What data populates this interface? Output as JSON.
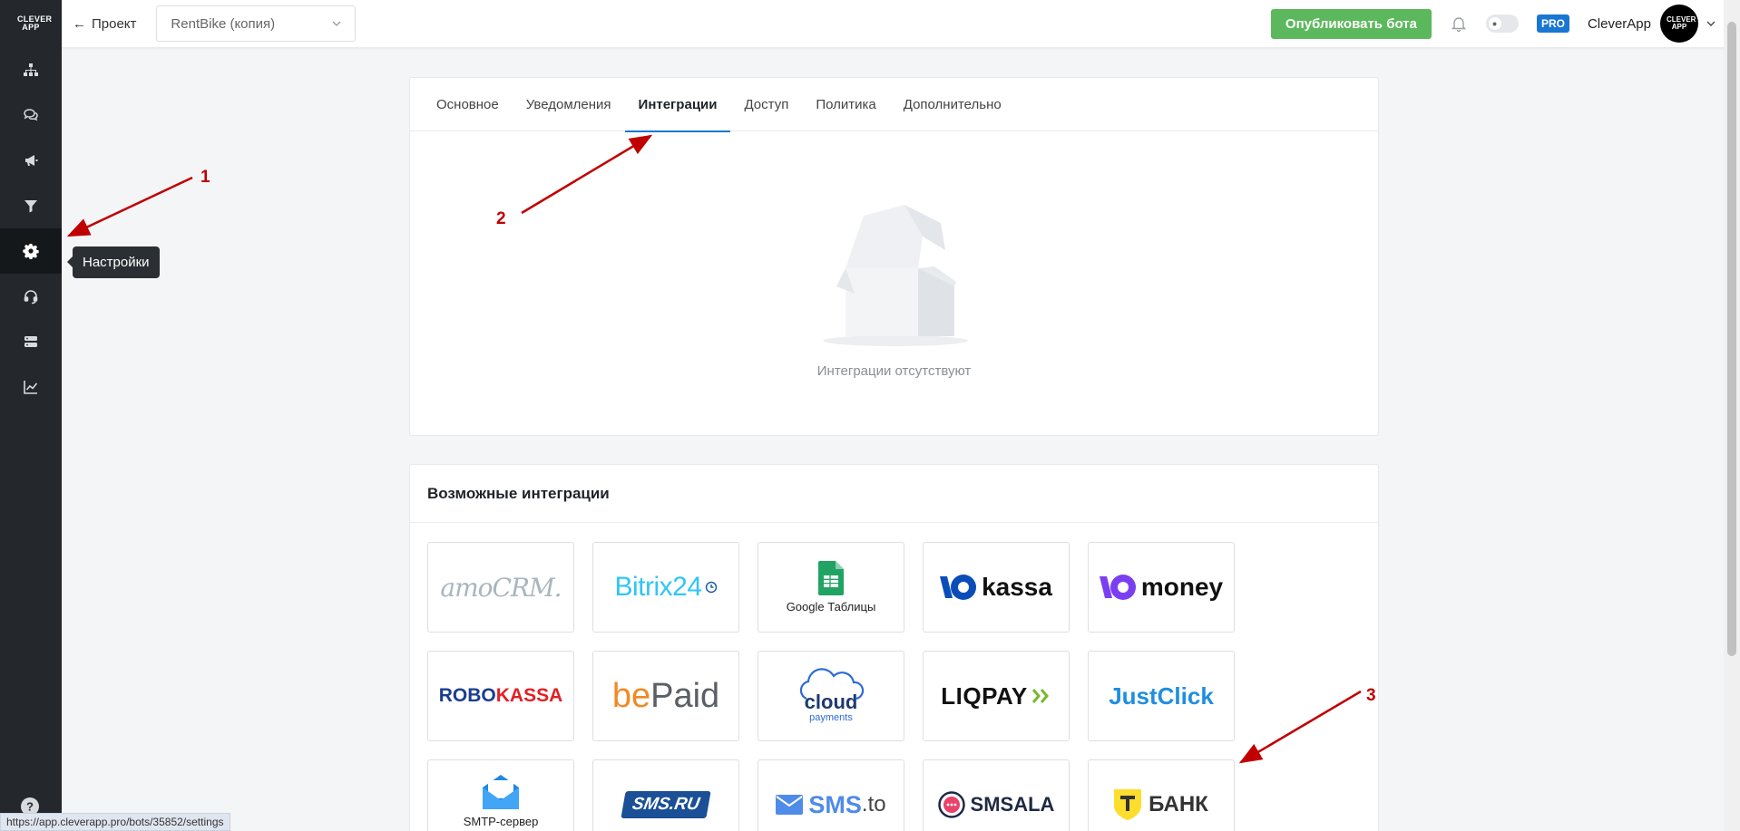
{
  "sidebar": {
    "logo": "CLEVER APP",
    "items": [
      {
        "icon": "sitemap-icon"
      },
      {
        "icon": "chat-icon"
      },
      {
        "icon": "megaphone-icon"
      },
      {
        "icon": "funnel-icon"
      },
      {
        "icon": "gear-icon",
        "active": true
      },
      {
        "icon": "headset-icon"
      },
      {
        "icon": "server-icon"
      },
      {
        "icon": "chart-line-icon"
      }
    ],
    "tooltip": "Настройки",
    "help_icon": "question-icon"
  },
  "topbar": {
    "back_label": "Проект",
    "project_value": "RentBike (копия)",
    "publish_label": "Опубликовать бота",
    "pro_badge": "PRO",
    "account_name": "CleverApp",
    "avatar_text": "CLEVER APP"
  },
  "settings": {
    "tabs": [
      "Основное",
      "Уведомления",
      "Интеграции",
      "Доступ",
      "Политика",
      "Дополнительно"
    ],
    "active_tab": "Интеграции",
    "empty_text": "Интеграции отсутствуют"
  },
  "available": {
    "title": "Возможные интеграции",
    "tiles": [
      {
        "name": "amocrm",
        "label": "amoCRM."
      },
      {
        "name": "bitrix24",
        "label": "Bitrix24"
      },
      {
        "name": "google-sheets",
        "label": "Google Таблицы"
      },
      {
        "name": "yookassa",
        "label": "kassa"
      },
      {
        "name": "yoomoney",
        "label": "money"
      },
      {
        "name": "robokassa",
        "label_a": "ROBO",
        "label_b": "KASSA"
      },
      {
        "name": "bepaid",
        "label_a": "be",
        "label_b": "Paid"
      },
      {
        "name": "cloudpayments",
        "label_a": "cloud",
        "label_b": "payments"
      },
      {
        "name": "liqpay",
        "label": "LIQPAY"
      },
      {
        "name": "justclick",
        "label": "JustClick"
      },
      {
        "name": "smtp",
        "label": "SMTP-сервер"
      },
      {
        "name": "smsru",
        "label": "SMS.RU"
      },
      {
        "name": "smsto",
        "label_a": "SMS",
        "label_b": ".to"
      },
      {
        "name": "smsala",
        "label": "SMSALA"
      },
      {
        "name": "tbank",
        "label": "БАНК"
      }
    ]
  },
  "annotations": [
    "1",
    "2",
    "3"
  ],
  "status_url": "https://app.cleverapp.pro/bots/35852/settings",
  "colors": {
    "sidebar": "#24282d",
    "accent": "#1976d2",
    "publish": "#5cb85c",
    "annotation": "#c00000"
  }
}
